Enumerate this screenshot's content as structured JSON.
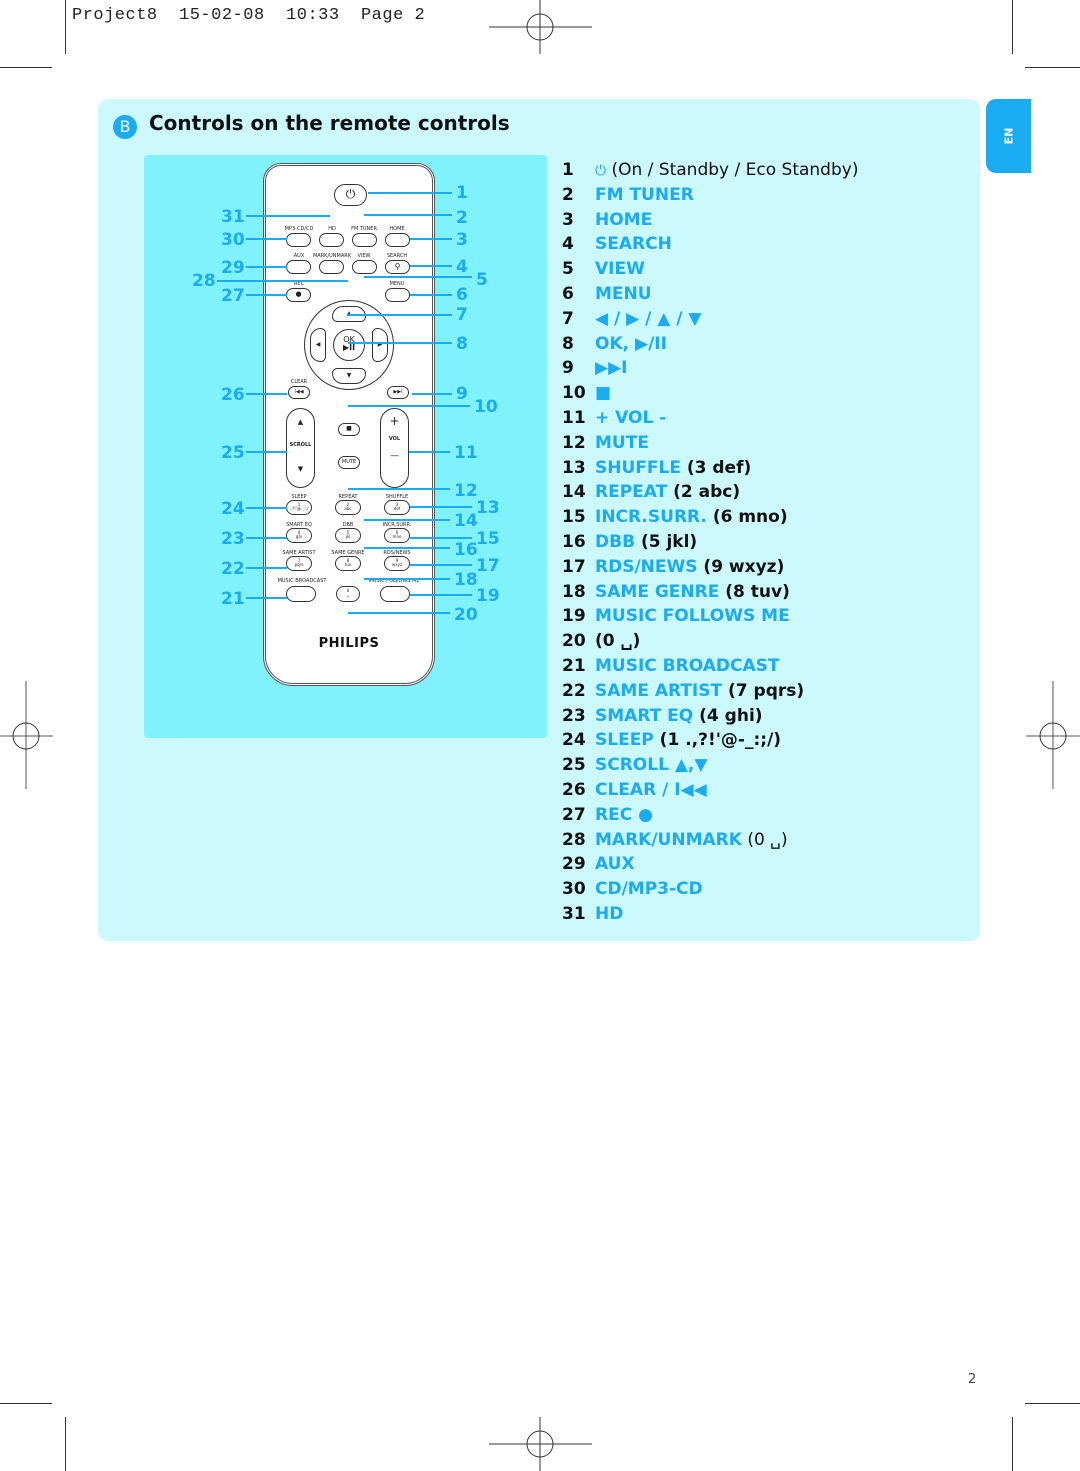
{
  "slug": {
    "project": "Project8",
    "date": "15-02-08",
    "time": "10:33",
    "page_label": "Page 2"
  },
  "lang_tab": "EN",
  "section": {
    "badge": "B",
    "title": "Controls on the remote controls"
  },
  "colors": {
    "accent": "#1aabf0",
    "section_bg": "#ccf9fe",
    "panel_bg": "#80f2fe",
    "text": "#111111"
  },
  "remote": {
    "brand": "PHILIPS",
    "buttons": {
      "power": "⏻",
      "mp3cd": "MP3-CD/CD",
      "hd": "HD",
      "fm_tuner": "FM TUNER",
      "home": "HOME",
      "aux": "AUX",
      "mark_unmark": "MARK/UNMARK",
      "view": "VIEW",
      "search": "SEARCH",
      "search_glyph": "⚲",
      "rec": "REC",
      "rec_glyph": "●",
      "menu": "MENU",
      "ok": "OK",
      "play_pause": "▶II",
      "up": "▲",
      "down": "▼",
      "left": "◀",
      "right": "▶",
      "clear": "CLEAR",
      "prev": "I◀◀",
      "next": "▶▶I",
      "stop": "■",
      "scroll": "SCROLL",
      "vol": "VOL",
      "plus": "+",
      "minus": "—",
      "mute": "MUTE",
      "sleep": "SLEEP",
      "repeat": "REPEAT",
      "shuffle": "SHUFFLE",
      "k1": "1",
      "k1s": ".,?!'@-_:;/",
      "k2": "2",
      "k2s": "abc",
      "k3": "3",
      "k3s": "def",
      "smart_eq": "SMART EQ",
      "dbb": "DBB",
      "incr_surr": "INCR.SURR.",
      "k4": "4",
      "k4s": "ghi",
      "k5": "5",
      "k5s": "jkl",
      "k6": "6",
      "k6s": "mno",
      "same_artist": "SAME ARTIST",
      "same_genre": "SAME GENRE",
      "rds_news": "RDS/NEWS",
      "k7": "7",
      "k7s": "pqrs",
      "k8": "8",
      "k8s": "tuv",
      "k9": "9",
      "k9s": "wxyz",
      "music_broadcast": "MUSIC BROADCAST",
      "music_follows_me": "MUSIC FOLLOWS ME",
      "k0": "0",
      "k0s": "␣"
    },
    "callouts": [
      "1",
      "2",
      "3",
      "4",
      "5",
      "6",
      "7",
      "8",
      "9",
      "10",
      "11",
      "12",
      "13",
      "14",
      "15",
      "16",
      "17",
      "18",
      "19",
      "20",
      "21",
      "22",
      "23",
      "24",
      "25",
      "26",
      "27",
      "28",
      "29",
      "30",
      "31"
    ]
  },
  "legend": [
    {
      "num": "1",
      "icon": "⏻",
      "desc": " (On / Standby / Eco Standby)"
    },
    {
      "num": "2",
      "key": "FM TUNER"
    },
    {
      "num": "3",
      "key": "HOME"
    },
    {
      "num": "4",
      "key": "SEARCH"
    },
    {
      "num": "5",
      "key": "VIEW"
    },
    {
      "num": "6",
      "key": "MENU"
    },
    {
      "num": "7",
      "key": "◀ / ▶ / ▲ / ▼"
    },
    {
      "num": "8",
      "key": "OK, ▶/II"
    },
    {
      "num": "9",
      "key": "▶▶I"
    },
    {
      "num": "10",
      "key": "■"
    },
    {
      "num": "11",
      "key": "+ VOL -"
    },
    {
      "num": "12",
      "key": "MUTE"
    },
    {
      "num": "13",
      "key": "SHUFFLE",
      "desc": " (3 def)"
    },
    {
      "num": "14",
      "key": "REPEAT",
      "desc": " (2 abc)"
    },
    {
      "num": "15",
      "key": "INCR.SURR.",
      "desc": " (6 mno)"
    },
    {
      "num": "16",
      "key": "DBB",
      "desc": " (5 jkl)"
    },
    {
      "num": "17",
      "key": "RDS/NEWS",
      "desc": " (9 wxyz)"
    },
    {
      "num": "18",
      "key": "SAME GENRE",
      "desc": " (8 tuv)"
    },
    {
      "num": "19",
      "key": "MUSIC FOLLOWS ME"
    },
    {
      "num": "20",
      "desc": "(0 ␣)"
    },
    {
      "num": "21",
      "key": "MUSIC BROADCAST"
    },
    {
      "num": "22",
      "key": "SAME ARTIST",
      "desc": " (7 pqrs)"
    },
    {
      "num": "23",
      "key": "SMART EQ",
      "desc": " (4 ghi)"
    },
    {
      "num": "24",
      "key": "SLEEP",
      "desc": " (1 .,?!'@-_:;/)"
    },
    {
      "num": "25",
      "key": "SCROLL ▲,▼"
    },
    {
      "num": "26",
      "key": "CLEAR / I◀◀"
    },
    {
      "num": "27",
      "key": "REC ●"
    },
    {
      "num": "28",
      "key": "MARK/UNMARK",
      "desc": " (0 ␣)"
    },
    {
      "num": "29",
      "key": "AUX"
    },
    {
      "num": "30",
      "key": "CD/MP3-CD"
    },
    {
      "num": "31",
      "key": "HD"
    }
  ],
  "page_number": "2"
}
